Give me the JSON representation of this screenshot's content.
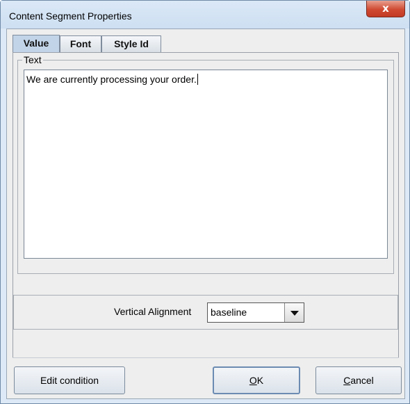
{
  "window": {
    "title": "Content Segment Properties",
    "close_glyph": "x"
  },
  "tabs": [
    {
      "label": "Value",
      "active": true
    },
    {
      "label": "Font",
      "active": false
    },
    {
      "label": "Style Id",
      "active": false
    }
  ],
  "value_tab": {
    "text_legend": "Text",
    "text_value": "We are currently processing your order.",
    "vertical_alignment_label": "Vertical Alignment",
    "vertical_alignment_value": "baseline"
  },
  "buttons": {
    "edit_condition": "Edit condition",
    "ok_mnemonic": "O",
    "ok_rest": "K",
    "cancel_mnemonic": "C",
    "cancel_rest": "ancel"
  },
  "colors": {
    "titlebar": "#cddff2",
    "close": "#c23a24",
    "active_tab": "#c2d4e8"
  }
}
